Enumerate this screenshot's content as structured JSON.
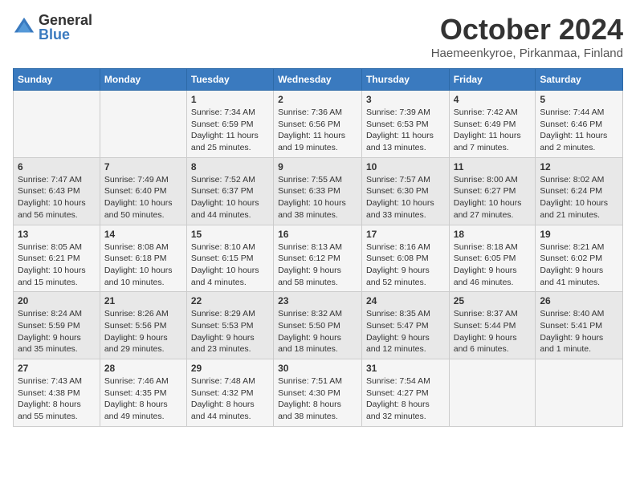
{
  "logo": {
    "general": "General",
    "blue": "Blue"
  },
  "title": "October 2024",
  "location": "Haemeenkyroe, Pirkanmaa, Finland",
  "days_header": [
    "Sunday",
    "Monday",
    "Tuesday",
    "Wednesday",
    "Thursday",
    "Friday",
    "Saturday"
  ],
  "weeks": [
    [
      {
        "day": "",
        "content": ""
      },
      {
        "day": "",
        "content": ""
      },
      {
        "day": "1",
        "content": "Sunrise: 7:34 AM\nSunset: 6:59 PM\nDaylight: 11 hours and 25 minutes."
      },
      {
        "day": "2",
        "content": "Sunrise: 7:36 AM\nSunset: 6:56 PM\nDaylight: 11 hours and 19 minutes."
      },
      {
        "day": "3",
        "content": "Sunrise: 7:39 AM\nSunset: 6:53 PM\nDaylight: 11 hours and 13 minutes."
      },
      {
        "day": "4",
        "content": "Sunrise: 7:42 AM\nSunset: 6:49 PM\nDaylight: 11 hours and 7 minutes."
      },
      {
        "day": "5",
        "content": "Sunrise: 7:44 AM\nSunset: 6:46 PM\nDaylight: 11 hours and 2 minutes."
      }
    ],
    [
      {
        "day": "6",
        "content": "Sunrise: 7:47 AM\nSunset: 6:43 PM\nDaylight: 10 hours and 56 minutes."
      },
      {
        "day": "7",
        "content": "Sunrise: 7:49 AM\nSunset: 6:40 PM\nDaylight: 10 hours and 50 minutes."
      },
      {
        "day": "8",
        "content": "Sunrise: 7:52 AM\nSunset: 6:37 PM\nDaylight: 10 hours and 44 minutes."
      },
      {
        "day": "9",
        "content": "Sunrise: 7:55 AM\nSunset: 6:33 PM\nDaylight: 10 hours and 38 minutes."
      },
      {
        "day": "10",
        "content": "Sunrise: 7:57 AM\nSunset: 6:30 PM\nDaylight: 10 hours and 33 minutes."
      },
      {
        "day": "11",
        "content": "Sunrise: 8:00 AM\nSunset: 6:27 PM\nDaylight: 10 hours and 27 minutes."
      },
      {
        "day": "12",
        "content": "Sunrise: 8:02 AM\nSunset: 6:24 PM\nDaylight: 10 hours and 21 minutes."
      }
    ],
    [
      {
        "day": "13",
        "content": "Sunrise: 8:05 AM\nSunset: 6:21 PM\nDaylight: 10 hours and 15 minutes."
      },
      {
        "day": "14",
        "content": "Sunrise: 8:08 AM\nSunset: 6:18 PM\nDaylight: 10 hours and 10 minutes."
      },
      {
        "day": "15",
        "content": "Sunrise: 8:10 AM\nSunset: 6:15 PM\nDaylight: 10 hours and 4 minutes."
      },
      {
        "day": "16",
        "content": "Sunrise: 8:13 AM\nSunset: 6:12 PM\nDaylight: 9 hours and 58 minutes."
      },
      {
        "day": "17",
        "content": "Sunrise: 8:16 AM\nSunset: 6:08 PM\nDaylight: 9 hours and 52 minutes."
      },
      {
        "day": "18",
        "content": "Sunrise: 8:18 AM\nSunset: 6:05 PM\nDaylight: 9 hours and 46 minutes."
      },
      {
        "day": "19",
        "content": "Sunrise: 8:21 AM\nSunset: 6:02 PM\nDaylight: 9 hours and 41 minutes."
      }
    ],
    [
      {
        "day": "20",
        "content": "Sunrise: 8:24 AM\nSunset: 5:59 PM\nDaylight: 9 hours and 35 minutes."
      },
      {
        "day": "21",
        "content": "Sunrise: 8:26 AM\nSunset: 5:56 PM\nDaylight: 9 hours and 29 minutes."
      },
      {
        "day": "22",
        "content": "Sunrise: 8:29 AM\nSunset: 5:53 PM\nDaylight: 9 hours and 23 minutes."
      },
      {
        "day": "23",
        "content": "Sunrise: 8:32 AM\nSunset: 5:50 PM\nDaylight: 9 hours and 18 minutes."
      },
      {
        "day": "24",
        "content": "Sunrise: 8:35 AM\nSunset: 5:47 PM\nDaylight: 9 hours and 12 minutes."
      },
      {
        "day": "25",
        "content": "Sunrise: 8:37 AM\nSunset: 5:44 PM\nDaylight: 9 hours and 6 minutes."
      },
      {
        "day": "26",
        "content": "Sunrise: 8:40 AM\nSunset: 5:41 PM\nDaylight: 9 hours and 1 minute."
      }
    ],
    [
      {
        "day": "27",
        "content": "Sunrise: 7:43 AM\nSunset: 4:38 PM\nDaylight: 8 hours and 55 minutes."
      },
      {
        "day": "28",
        "content": "Sunrise: 7:46 AM\nSunset: 4:35 PM\nDaylight: 8 hours and 49 minutes."
      },
      {
        "day": "29",
        "content": "Sunrise: 7:48 AM\nSunset: 4:32 PM\nDaylight: 8 hours and 44 minutes."
      },
      {
        "day": "30",
        "content": "Sunrise: 7:51 AM\nSunset: 4:30 PM\nDaylight: 8 hours and 38 minutes."
      },
      {
        "day": "31",
        "content": "Sunrise: 7:54 AM\nSunset: 4:27 PM\nDaylight: 8 hours and 32 minutes."
      },
      {
        "day": "",
        "content": ""
      },
      {
        "day": "",
        "content": ""
      }
    ]
  ]
}
